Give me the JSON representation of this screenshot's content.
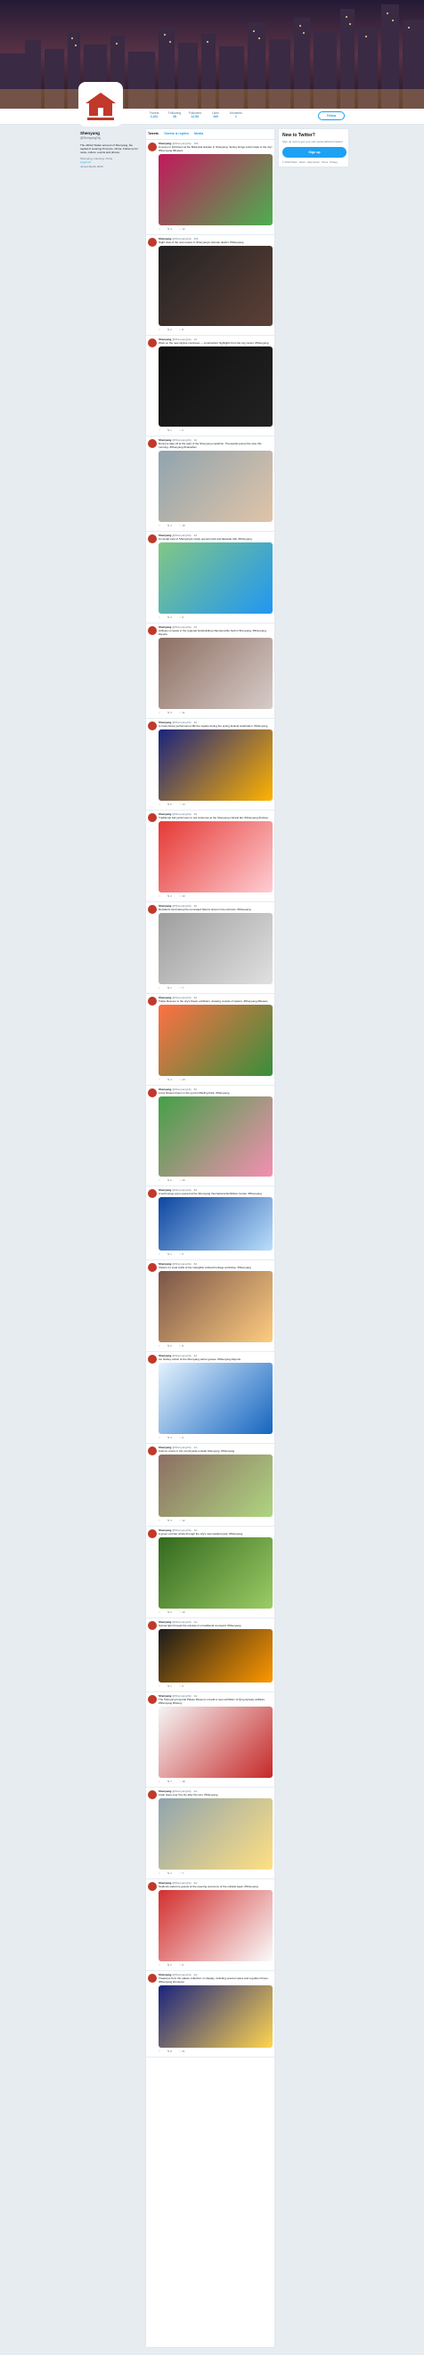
{
  "profile": {
    "name": "Shenyang",
    "handle": "@ShenyangCity",
    "bio": "The official Twitter account of Shenyang, the capital of Liaoning Province, China. Follow us for news, culture, events and photos.",
    "location": "Shenyang, Liaoning, China",
    "website": "sy.gov.cn",
    "joined": "Joined March 2018"
  },
  "nav": [
    {
      "label": "Tweets",
      "num": "2,431"
    },
    {
      "label": "Following",
      "num": "38"
    },
    {
      "label": "Followers",
      "num": "12.5K"
    },
    {
      "label": "Likes",
      "num": "169"
    },
    {
      "label": "Moments",
      "num": "1"
    }
  ],
  "follow_label": "Follow",
  "tabs": [
    "Tweets",
    "Tweets & replies",
    "Media"
  ],
  "widget": {
    "title": "New to Twitter?",
    "subtitle": "Sign up now to get your own personalized timeline!",
    "button": "Sign up",
    "footer": "© 2019 Twitter · About · Help Center · Terms · Privacy"
  },
  "tweets": [
    {
      "name": "Shenyang",
      "handle": "@ShenyangCity · 19h",
      "text": "A peony in full bloom at the Botanical Garden in Shenyang. Spring brings colors back to the city! #Shenyang #flowers",
      "likes": "12",
      "rts": "3"
    },
    {
      "name": "Shenyang",
      "handle": "@ShenyangCity · 20h",
      "text": "Night view of the new towers in Shenyang's Hunnan district. #Shenyang",
      "likes": "8",
      "rts": "2"
    },
    {
      "name": "Shenyang",
      "handle": "@ShenyangCity · 1d",
      "text": "Work on the new skyline continues — construction highlights from the city center. #Shenyang",
      "likes": "6",
      "rts": "1"
    },
    {
      "name": "Shenyang",
      "handle": "@ShenyangCity · 1d",
      "text": "Runners take off at the start of the Shenyang marathon. Thousands joined the race this morning. #Shenyang #marathon",
      "likes": "15",
      "rts": "4"
    },
    {
      "name": "Shenyang",
      "handle": "@ShenyangCity · 2d",
      "text": "An aerial view of Shenyang's newly opened park and lakeside trail. #Shenyang",
      "likes": "9",
      "rts": "2"
    },
    {
      "name": "Shenyang",
      "handle": "@ShenyangCity · 2d",
      "text": "Athletes compete in the regional bodybuilding championship held in Shenyang. #Shenyang #sports",
      "likes": "11",
      "rts": "3"
    },
    {
      "name": "Shenyang",
      "handle": "@ShenyangCity · 3d",
      "text": "A mass dance performance fills the square during the spring festival celebration. #Shenyang",
      "likes": "14",
      "rts": "5"
    },
    {
      "name": "Shenyang",
      "handle": "@ShenyangCity · 3d",
      "text": "Traditional folk performers in red costumes at the Shenyang cultural fair. #Shenyang #culture",
      "likes": "10",
      "rts": "2"
    },
    {
      "name": "Shenyang",
      "handle": "@ShenyangCity · 4d",
      "text": "Residents stroll along the renovated historic street in the old town. #Shenyang",
      "likes": "7",
      "rts": "1"
    },
    {
      "name": "Shenyang",
      "handle": "@ShenyangCity · 4d",
      "text": "Tulips blossom in the city's flower exhibition, drawing crowds of visitors. #Shenyang #flowers",
      "likes": "13",
      "rts": "4"
    },
    {
      "name": "Shenyang",
      "handle": "@ShenyangCity · 5d",
      "text": "Lotus flowers bloom in the pond of Beiling Park. #Shenyang",
      "likes": "16",
      "rts": "6"
    },
    {
      "name": "Shenyang",
      "handle": "@ShenyangCity · 5d",
      "text": "A technology expo opened at the Shenyang International Exhibition Center. #Shenyang",
      "likes": "5",
      "rts": "1"
    },
    {
      "name": "Shenyang",
      "handle": "@ShenyangCity · 6d",
      "text": "Visitors try local crafts at the intangible cultural heritage workshop. #Shenyang",
      "likes": "8",
      "rts": "2"
    },
    {
      "name": "Shenyang",
      "handle": "@ShenyangCity · 6d",
      "text": "Ice hockey action at the Shenyang winter games. #Shenyang #sports",
      "likes": "9",
      "rts": "3"
    },
    {
      "name": "Shenyang",
      "handle": "@ShenyangCity · 1w",
      "text": "Autumn colors in the countryside outside Shenyang. #Shenyang",
      "likes": "12",
      "rts": "3"
    },
    {
      "name": "Shenyang",
      "handle": "@ShenyangCity · 1w",
      "text": "A green corridor winds through the city's new wetland park. #Shenyang",
      "likes": "10",
      "rts": "2"
    },
    {
      "name": "Shenyang",
      "handle": "@ShenyangCity · 1w",
      "text": "Sunset light through the window of a traditional courtyard. #Shenyang",
      "likes": "6",
      "rts": "1"
    },
    {
      "name": "Shenyang",
      "handle": "@ShenyangCity · 1w",
      "text": "The Shenyang Imperial Palace Museum unveils a new exhibition of Qing dynasty artifacts. #Shenyang #history",
      "likes": "18",
      "rts": "7"
    },
    {
      "name": "Shenyang",
      "handle": "@ShenyangCity · 2w",
      "text": "Clear skies over the city after the rain. #Shenyang",
      "likes": "7",
      "rts": "1"
    },
    {
      "name": "Shenyang",
      "handle": "@ShenyangCity · 2w",
      "text": "Students welcome guests at the opening ceremony of the cultural week. #Shenyang",
      "likes": "9",
      "rts": "2"
    },
    {
      "name": "Shenyang",
      "handle": "@ShenyangCity · 2w",
      "text": "Treasures from the palace collection on display, including enamel vases and a golden throne. #Shenyang #museum",
      "likes": "21",
      "rts": "8"
    }
  ]
}
